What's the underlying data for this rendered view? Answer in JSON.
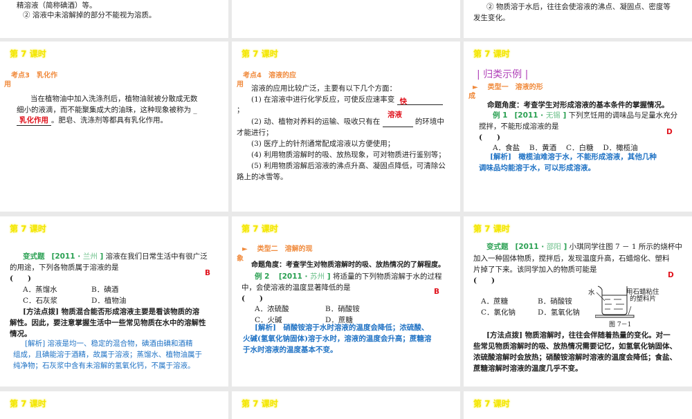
{
  "lesson_title": "第 7 课时",
  "slides": {
    "s1": {
      "l1": "精溶液（简称碘酒）等。",
      "l2": "② 溶液中未溶解掉的部分不能视为溶质。"
    },
    "s3": {
      "l1": "② 物质溶于水后，往往会使溶液的沸点、凝固点、密度等",
      "l2": "发生变化。"
    },
    "s4": {
      "heading1": "考点3　乳化作",
      "heading2": "用",
      "l1": "当在植物油中加入洗涤剂后，植物油就被分散成无数",
      "l2": "细小的液滴，而不能聚集成大的油珠，这种现象被称为 _",
      "answer": "乳化作用",
      "l3": "。肥皂、洗涤剂等都具有乳化作用。"
    },
    "s5": {
      "heading1": "考点4　溶液的应",
      "heading2": "用",
      "intro": "溶液的应用比较广泛，主要有以下几个方面：",
      "i1": "(1) 在溶液中进行化学反应，可使反应速率变",
      "a1": "快",
      "semi": "；",
      "a2": "溶液",
      "i2a": "(2) 动、植物对养料的运输、吸收只有在",
      "i2b": "的环境中",
      "i2c": "才能进行；",
      "i3": "(3) 医疗上的针剂通常配成溶液以方便使用；",
      "i4": "(4) 利用物质溶解时的吸、放热现象，可对物质进行鉴别等；",
      "i5a": "(5) 利用物质溶解后溶液的沸点升高、凝固点降低，可清除公",
      "i5b": "路上的冰雪等。"
    },
    "s6": {
      "section": "| 归类示例 |",
      "type1": "类型一　溶液的形",
      "type2": "成",
      "angle": "命题角度：考查学生对形成溶液的基本条件的掌握情况。",
      "ex_label": "例 1",
      "src_a": "[2011 · ",
      "src_city": "无锡",
      "src_b": " ]",
      "q1": " 下列烹饪用的调味品与足量水充分",
      "q2": "搅拌，不能形成溶液的是",
      "paren": "(　　)",
      "answer": "D",
      "opts": "A．食盐　 B．黄酒　 C．白糖　 D．橄榄油",
      "ana_label": "[解析]",
      "ana1": "　橄榄油难溶于水，不能形成溶液，其他几种",
      "ana2": "调味品均能溶于水，可以形成溶液。"
    },
    "s7": {
      "label": "变式题",
      "src_a": "[2011 · ",
      "src_city": "兰州",
      "src_b": " ]",
      "q1": " 溶液在我们日常生活中有很广泛",
      "q2": "的用途，下列各物质属于溶液的是",
      "paren": "(　　)",
      "answer": "B",
      "oA": "A．蒸馏水",
      "oB": "B．碘酒",
      "oC": "C．石灰浆",
      "oD": "D．植物油",
      "m_label": "[方法点拨]",
      "m1": " 物质混合能否形成溶液主要是看该物质的溶",
      "m2": "解性。因此，要注意掌握生活中一些常见物质在水中的溶解性",
      "m3": "情况。",
      "a1": "[解析] 溶液是均一、稳定的混合物，碘酒由碘和酒精",
      "a2": "组成，且碘能溶于酒精，故属于溶液；蒸馏水、植物油属于",
      "a3": "纯净物；石灰浆中含有未溶解的氢氧化钙，不属于溶液。"
    },
    "s8": {
      "type1": "类型二　溶解的现",
      "type2": "象",
      "angle": "命题角度：考查学生对物质溶解时的吸、放热情况的了解程度。",
      "ex_label": "例 2",
      "src_a": "[2011 · ",
      "src_city": "苏州",
      "src_b": " ]",
      "q1": " 将适量的下列物质溶解于水的过程",
      "q2": "中，会使溶液的温度显著降低的是",
      "paren": "(　　)",
      "answer": "B",
      "oA": "A．浓硫酸",
      "oB": "B．硝酸铵",
      "oC": "C．火碱",
      "oD": "D．蔗糖",
      "a1": "[解析]　硝酸铵溶于水时溶液的温度会降低；浓硫酸、",
      "a2": "火碱(氢氧化钠固体)溶于水时，溶液的温度会升高；蔗糖溶",
      "a3": "于水时溶液的温度基本不变。"
    },
    "s9": {
      "label": "变式题",
      "src_a": "[2011 · ",
      "src_city": "邵阳",
      "src_b": " ]",
      "q1": " 小琪同学往图 7 － 1 所示的烧杯中",
      "q2": "加入一种固体物质，搅拌后，发现温度升高，石蜡熔化、塑料",
      "q3": "片掉了下来。该同学加入的物质可能是",
      "paren": "(　　)",
      "answer": "D",
      "oA": "A．蔗糖",
      "oB": "B．硝酸铵",
      "oC": "C．氯化钠",
      "oD": "D．氢氧化钠",
      "fig_water": "水",
      "fig_label1": "用石蜡粘住",
      "fig_label2": "的塑料片",
      "fig_caption": "图 7－1",
      "m_label": "[方法点拨]",
      "m1": " 物质溶解时，往往会伴随着热量的变化。对一",
      "m2": "些常见物质溶解时的吸、放热情况需要记忆，如氢氧化钠固体、",
      "m3": "浓硫酸溶解时会放热；硝酸铵溶解时溶液的温度会降低；食盐、",
      "m4": "蔗糖溶解时溶液的温度几乎不变。"
    }
  }
}
